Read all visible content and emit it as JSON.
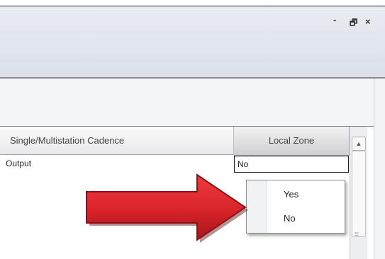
{
  "window": {
    "controls": {
      "minimize": "-",
      "restore": "🗗",
      "close": "×"
    }
  },
  "grid": {
    "columns": [
      "Single/Multistation Cadence",
      "Local Zone"
    ],
    "row": {
      "cadence_value": "Output",
      "local_zone_value": "No"
    }
  },
  "dropdown": {
    "options": [
      "Yes",
      "No"
    ]
  },
  "icons": {
    "scroll_up": "▲",
    "scroll_grip": "≡",
    "pointer": "red-arrow-icon"
  },
  "colors": {
    "arrow": "#d8232a",
    "arrow_dark": "#8e1015"
  }
}
